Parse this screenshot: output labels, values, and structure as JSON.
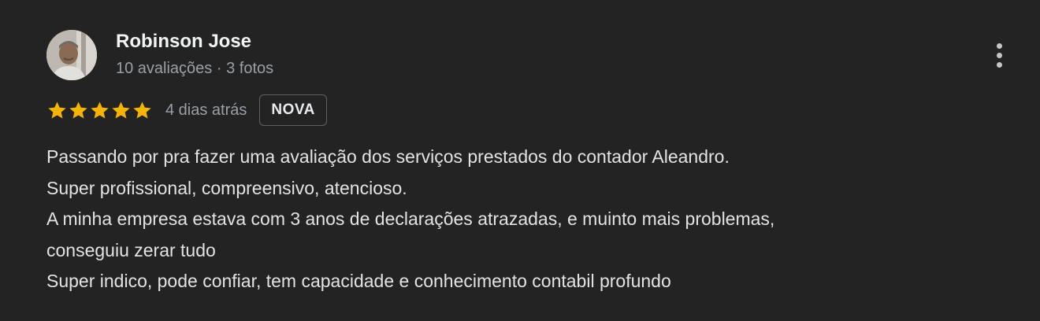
{
  "reviewer": {
    "name": "Robinson Jose",
    "meta": "10 avaliações · 3 fotos"
  },
  "rating": {
    "stars": 5,
    "max_stars": 5,
    "star_color": "#f5b400",
    "time_ago": "4 dias atrás",
    "badge": "NOVA"
  },
  "review": {
    "lines": [
      "Passando por pra fazer uma avaliação dos serviços prestados do contador Aleandro.",
      "Super profissional, compreensivo, atencioso.",
      "A minha empresa estava com 3 anos de declarações atrazadas, e muinto mais problemas,",
      "conseguiu zerar tudo",
      "Super indico, pode confiar, tem capacidade e conhecimento contabil profundo"
    ]
  },
  "icons": {
    "avatar": "avatar-photo",
    "more": "more-vert-icon",
    "star": "star-icon"
  },
  "colors": {
    "background": "#232323",
    "text_primary": "#e8eaed",
    "text_secondary": "#9aa0a6"
  }
}
